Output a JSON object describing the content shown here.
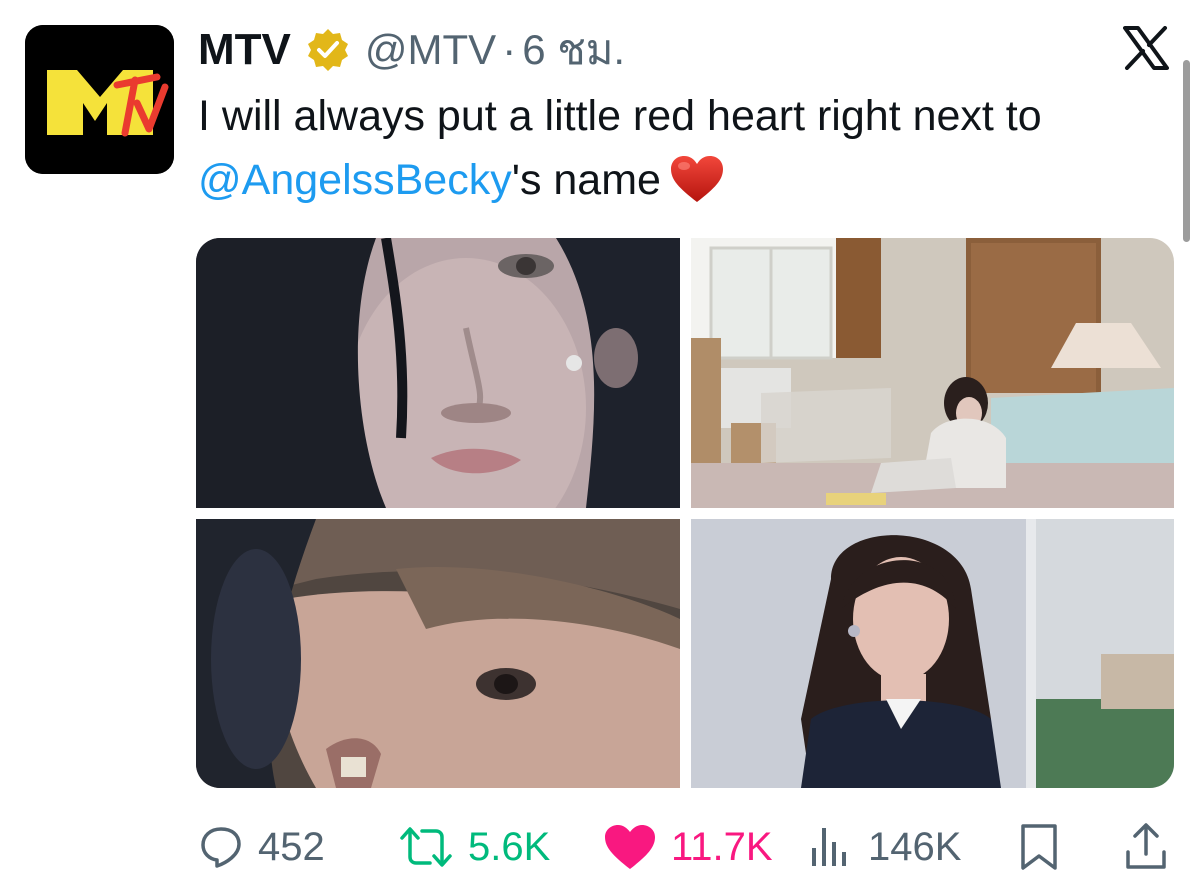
{
  "tweet": {
    "author_name": "MTV",
    "handle": "@MTV",
    "separator": "·",
    "time": "6 ชม.",
    "text_part1": "I will always put a little red heart right next to ",
    "mention": "@AngelssBecky",
    "text_part2": "'s name"
  },
  "metrics": {
    "replies": "452",
    "retweets": "5.6K",
    "likes": "11.7K",
    "views": "146K"
  },
  "colors": {
    "mention": "#1d9bf0",
    "retweet_active": "#00ba7c",
    "like_active": "#f91880",
    "secondary_text": "#536471",
    "verified_badge": "#e2b719",
    "mtv_yellow": "#f5e23a",
    "mtv_red": "#ea3b2f"
  },
  "icons": {
    "avatar": "mtv-logo",
    "badge": "verified-gold-badge-icon",
    "platform": "x-logo-icon",
    "emoji": "red-heart-emoji",
    "reply": "speech-bubble-icon",
    "retweet": "retweet-arrows-icon",
    "like": "heart-filled-icon",
    "views": "bar-chart-icon",
    "bookmark": "bookmark-icon",
    "share": "share-upload-icon"
  },
  "media": {
    "count": 4
  }
}
